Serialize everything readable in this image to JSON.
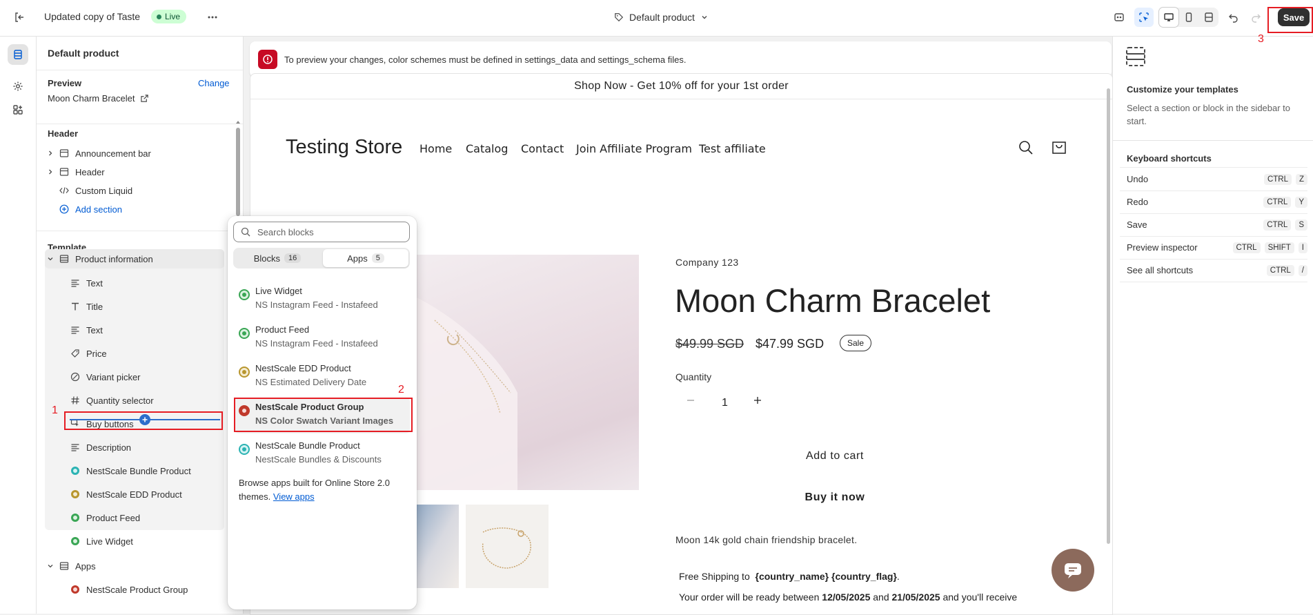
{
  "topbar": {
    "theme_name": "Updated copy of Taste",
    "live_label": "Live",
    "template_selector": "Default product",
    "save_label": "Save"
  },
  "sidebar": {
    "title": "Default product",
    "preview_label": "Preview",
    "change_label": "Change",
    "preview_product": "Moon Charm Bracelet",
    "header_heading": "Header",
    "header_items": [
      "Announcement bar",
      "Header",
      "Custom Liquid"
    ],
    "add_section_label": "Add section",
    "template_heading": "Template",
    "product_info_label": "Product information",
    "blocks": [
      "Text",
      "Title",
      "Text",
      "Price",
      "Variant picker",
      "Quantity selector",
      "Buy buttons",
      "Description",
      "NestScale Bundle Product",
      "NestScale EDD Product",
      "Product Feed",
      "Live Widget"
    ],
    "apps_label": "Apps",
    "apps_items": [
      "NestScale Product Group"
    ]
  },
  "banner": {
    "message": "To preview your changes, color schemes must be defined in settings_data and settings_schema files."
  },
  "store": {
    "announcement": "Shop Now - Get 10% off for your 1st order",
    "logo": "Testing Store",
    "nav": [
      "Home",
      "Catalog",
      "Contact",
      "Join Affiliate Program",
      "Test affiliate"
    ],
    "vendor": "Company 123",
    "product_title": "Moon Charm Bracelet",
    "price_old": "$49.99 SGD",
    "price_new": "$47.99 SGD",
    "sale_badge": "Sale",
    "quantity_label": "Quantity",
    "quantity_value": "1",
    "add_to_cart": "Add to cart",
    "buy_now": "Buy it now",
    "description": "Moon 14k gold chain friendship bracelet.",
    "shipping_prefix": "Free Shipping to",
    "shipping_vars": "{country_name} {country_flag}",
    "shipping_end": ".",
    "ready_prefix": "Your order will be ready between",
    "ready_date1": "12/05/2025",
    "ready_and": "and",
    "ready_date2": "21/05/2025",
    "ready_suffix": "and you'll receive"
  },
  "popover": {
    "search_placeholder": "Search blocks",
    "tab_blocks": "Blocks",
    "tab_blocks_count": "16",
    "tab_apps": "Apps",
    "tab_apps_count": "5",
    "items": [
      {
        "title": "Live Widget",
        "subtitle": "NS Instagram Feed - Instafeed",
        "color": "#3aa655"
      },
      {
        "title": "Product Feed",
        "subtitle": "NS Instagram Feed - Instafeed",
        "color": "#3aa655"
      },
      {
        "title": "NestScale EDD Product",
        "subtitle": "NS Estimated Delivery Date",
        "color": "#b8962e"
      },
      {
        "title": "NestScale Product Group",
        "subtitle": "NS Color Swatch Variant Images",
        "color": "#c0392b"
      },
      {
        "title": "NestScale Bundle Product",
        "subtitle": "NestScale Bundles & Discounts",
        "color": "#2bb3b3"
      }
    ],
    "footer_text": "Browse apps built for Online Store 2.0 themes.",
    "footer_link": "View apps"
  },
  "right_panel": {
    "title": "Customize your templates",
    "desc": "Select a section or block in the sidebar to start.",
    "shortcuts_heading": "Keyboard shortcuts",
    "shortcuts": [
      {
        "label": "Undo",
        "keys": [
          "CTRL",
          "Z"
        ]
      },
      {
        "label": "Redo",
        "keys": [
          "CTRL",
          "Y"
        ]
      },
      {
        "label": "Save",
        "keys": [
          "CTRL",
          "S"
        ]
      },
      {
        "label": "Preview inspector",
        "keys": [
          "CTRL",
          "SHIFT",
          "I"
        ]
      },
      {
        "label": "See all shortcuts",
        "keys": [
          "CTRL",
          "/"
        ]
      }
    ]
  },
  "annotations": [
    "1",
    "2",
    "3"
  ],
  "colors": {
    "live_bg": "#cdfed4",
    "accent_blue": "#005bd3",
    "error_red": "#c70a24",
    "annotation_red": "#e51c23"
  }
}
